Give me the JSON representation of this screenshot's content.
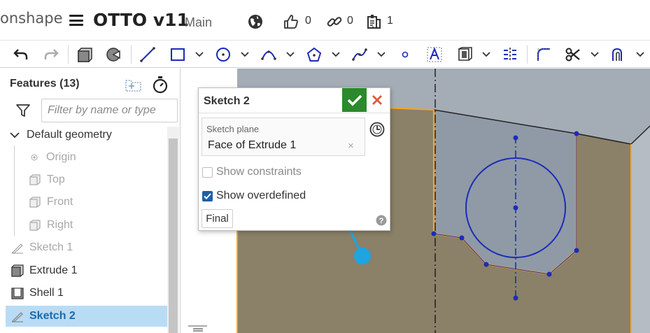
{
  "app": {
    "brand": "onshape",
    "document_title": "OTTO v11",
    "branch": "Main",
    "likes_count": "0",
    "links_count": "0",
    "versions_count": "1"
  },
  "toolbar": {
    "icons": [
      "undo-icon",
      "redo-icon",
      "extrude-icon",
      "revolve-icon",
      "line-icon",
      "rectangle-icon",
      "circle-icon",
      "arc-icon",
      "polygon-icon",
      "spline-icon",
      "point-icon",
      "text-icon",
      "face-icon",
      "mirror-icon",
      "fillet-icon",
      "trim-icon",
      "offset-icon"
    ]
  },
  "feature_panel": {
    "title": "Features (13)",
    "filter_placeholder": "Filter by name or type",
    "tree": [
      {
        "label": "Default geometry",
        "icon": "chevron-down-icon"
      },
      {
        "label": "Origin",
        "icon": "origin-icon"
      },
      {
        "label": "Top",
        "icon": "plane-icon"
      },
      {
        "label": "Front",
        "icon": "plane-icon"
      },
      {
        "label": "Right",
        "icon": "plane-icon"
      },
      {
        "label": "Sketch 1",
        "icon": "sketch-icon"
      },
      {
        "label": "Extrude 1",
        "icon": "extrude-icon"
      },
      {
        "label": "Shell 1",
        "icon": "shell-icon"
      },
      {
        "label": "Sketch 2",
        "icon": "sketch-icon"
      }
    ]
  },
  "sketch_dialog": {
    "title": "Sketch 2",
    "plane_label": "Sketch plane",
    "plane_value": "Face of Extrude 1",
    "clear_symbol": "×",
    "show_constraints": "Show constraints",
    "show_constraints_checked": false,
    "show_overdefined": "Show overdefined",
    "show_overdefined_checked": true,
    "final_label": "Final"
  },
  "colors": {
    "accept_green": "#2b8a2b",
    "cancel_red": "#e05a3a",
    "selection_blue": "#b9dcf5",
    "sketch_blue": "#1d2bb8",
    "edge_orange": "#f5a623",
    "face_tan": "#8b8068",
    "arrow_blue": "#1ca5e0"
  }
}
